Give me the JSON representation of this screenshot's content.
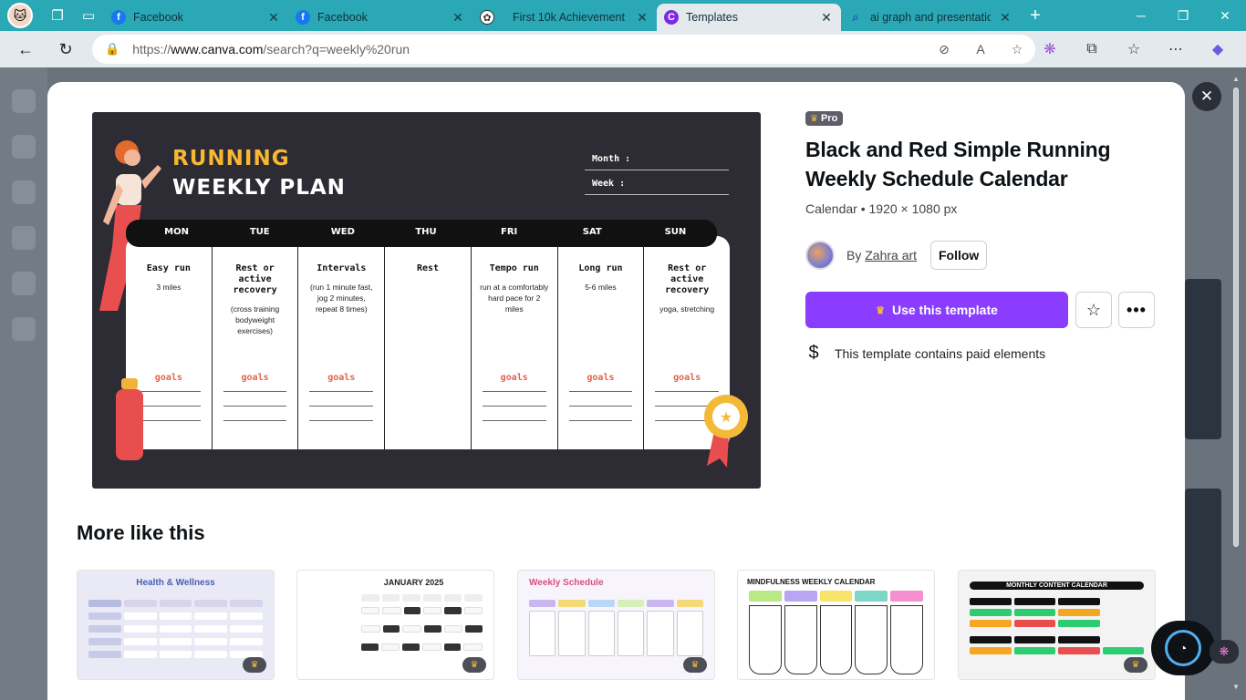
{
  "browser": {
    "tabs": [
      {
        "title": "Facebook",
        "icon": "facebook-icon"
      },
      {
        "title": "Facebook",
        "icon": "facebook-icon"
      },
      {
        "title": "First 10k Achievement",
        "icon": "chatgpt-icon"
      },
      {
        "title": "Templates",
        "icon": "canva-icon"
      },
      {
        "title": "ai graph and presentation",
        "icon": "search-icon"
      }
    ],
    "url_prefix": "https://",
    "url_domain": "www.canva.com",
    "url_path": "/search?q=weekly%20run"
  },
  "template": {
    "badge": "Pro",
    "title": "Black and Red Simple Running Weekly Schedule Calendar",
    "meta": "Calendar • 1920 × 1080 px",
    "author_prefix": "By",
    "author": "Zahra art",
    "follow_label": "Follow",
    "use_label": "Use this template",
    "paid_notice": "This template contains paid elements"
  },
  "preview": {
    "title_line1": "RUNNING",
    "title_line2": "WEEKLY PLAN",
    "month_label": "Month  :",
    "week_label": "Week   :",
    "days": [
      {
        "day": "MON",
        "title": "Easy run",
        "note": "3 miles",
        "goal": "goals"
      },
      {
        "day": "TUE",
        "title": "Rest or active recovery",
        "note": "(cross training bodyweight exercises)",
        "goal": "goals"
      },
      {
        "day": "WED",
        "title": "Intervals",
        "note": "(run 1 minute fast, jog 2 minutes, repeat 8 times)",
        "goal": "goals"
      },
      {
        "day": "THU",
        "title": "Rest",
        "note": "",
        "goal": ""
      },
      {
        "day": "FRI",
        "title": "Tempo run",
        "note": "run at a comfortably hard pace for 2 miles",
        "goal": "goals"
      },
      {
        "day": "SAT",
        "title": "Long run",
        "note": "5-6 miles",
        "goal": "goals"
      },
      {
        "day": "SUN",
        "title": "Rest or active recovery",
        "note": "yoga, stretching",
        "goal": "goals"
      }
    ]
  },
  "more": {
    "heading": "More like this",
    "items": [
      {
        "caption": "Health & Wellness",
        "pro": true,
        "bg": "#e9eaf6",
        "accent": "#4a5fb0"
      },
      {
        "caption": "JANUARY 2025",
        "pro": true,
        "bg": "#ffffff",
        "accent": "#222222"
      },
      {
        "caption": "Weekly Schedule",
        "pro": true,
        "bg": "#f7f4fb",
        "accent": "#d94c8a"
      },
      {
        "caption": "MINDFULNESS WEEKLY CALENDAR",
        "pro": false,
        "bg": "#ffffff",
        "accent": "#111111"
      },
      {
        "caption": "MONTHLY CONTENT CALENDAR",
        "pro": true,
        "bg": "#f3f3f3",
        "accent": "#111111"
      }
    ]
  },
  "colors": {
    "tabbar": "#2aa8b5",
    "primary_button": "#8b3dff",
    "preview_bg": "#2d2b33",
    "title_yellow": "#f7b733",
    "goal_red": "#e0624d"
  }
}
